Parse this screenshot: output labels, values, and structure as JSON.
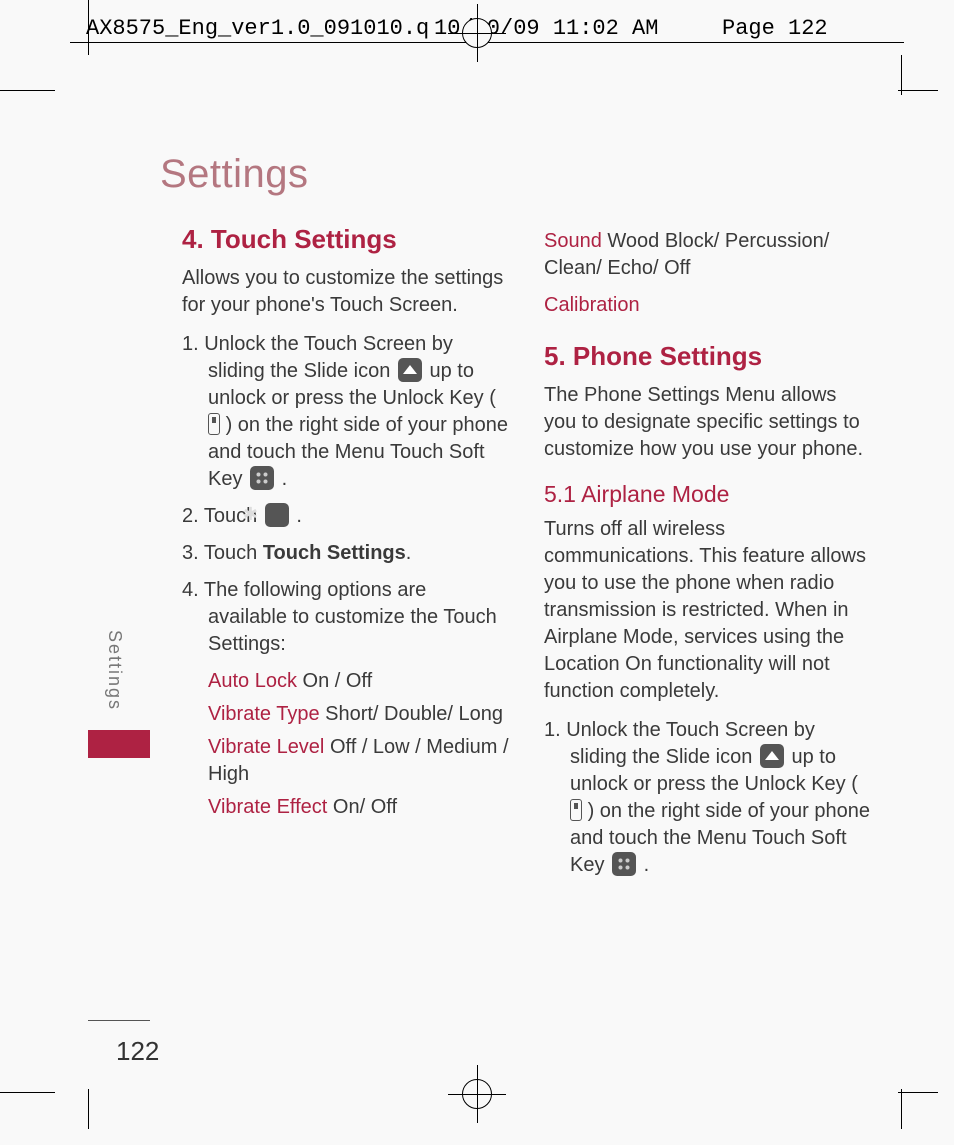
{
  "crop": {
    "filename": "AX8575_Eng_ver1.0_091010.qxd",
    "datetime": "10/10/09  11:02 AM",
    "pagelabel": "Page 122"
  },
  "page": {
    "title": "Settings",
    "side_tab": "Settings",
    "number": "122"
  },
  "left": {
    "h4": "4. Touch Settings",
    "intro": "Allows you to customize the settings for your phone's Touch Screen.",
    "step1a": "1. Unlock the Touch Screen by sliding the Slide icon ",
    "step1b": " up to unlock or press the Unlock Key ( ",
    "step1c": " ) on the right side of your phone and touch the Menu Touch Soft Key ",
    "step1d": " .",
    "step2a": "2. Touch  ",
    "step2b": " .",
    "step3a": "3. Touch ",
    "step3b": "Touch Settings",
    "step3c": ".",
    "step4": "4. The following options are available to customize the Touch Settings:",
    "opt_autolock_label": "Auto Lock",
    "opt_autolock_vals": " On / Off",
    "opt_vibtype_label": "Vibrate Type",
    "opt_vibtype_vals": " Short/ Double/ Long",
    "opt_viblevel_label": "Vibrate Level",
    "opt_viblevel_vals": " Off / Low / Medium / High",
    "opt_vibeffect_label": "Vibrate Effect",
    "opt_vibeffect_vals": " On/ Off"
  },
  "right": {
    "sound_label": "Sound",
    "sound_vals": " Wood Block/ Percussion/ Clean/ Echo/ Off",
    "calibration": "Calibration",
    "h5": "5. Phone Settings",
    "intro5": "The Phone Settings Menu allows you to designate specific settings to customize how you use your phone.",
    "h51": "5.1 Airplane Mode",
    "para51": "Turns off all wireless communications. This feature allows you to use the phone when radio transmission is restricted. When in Airplane Mode, services using the Location On functionality will not function completely.",
    "step1a": "1. Unlock the Touch Screen by sliding the Slide icon ",
    "step1b": " up to unlock or press the Unlock Key ( ",
    "step1c": " ) on the right side of your phone and touch the Menu Touch Soft Key ",
    "step1d": " ."
  }
}
